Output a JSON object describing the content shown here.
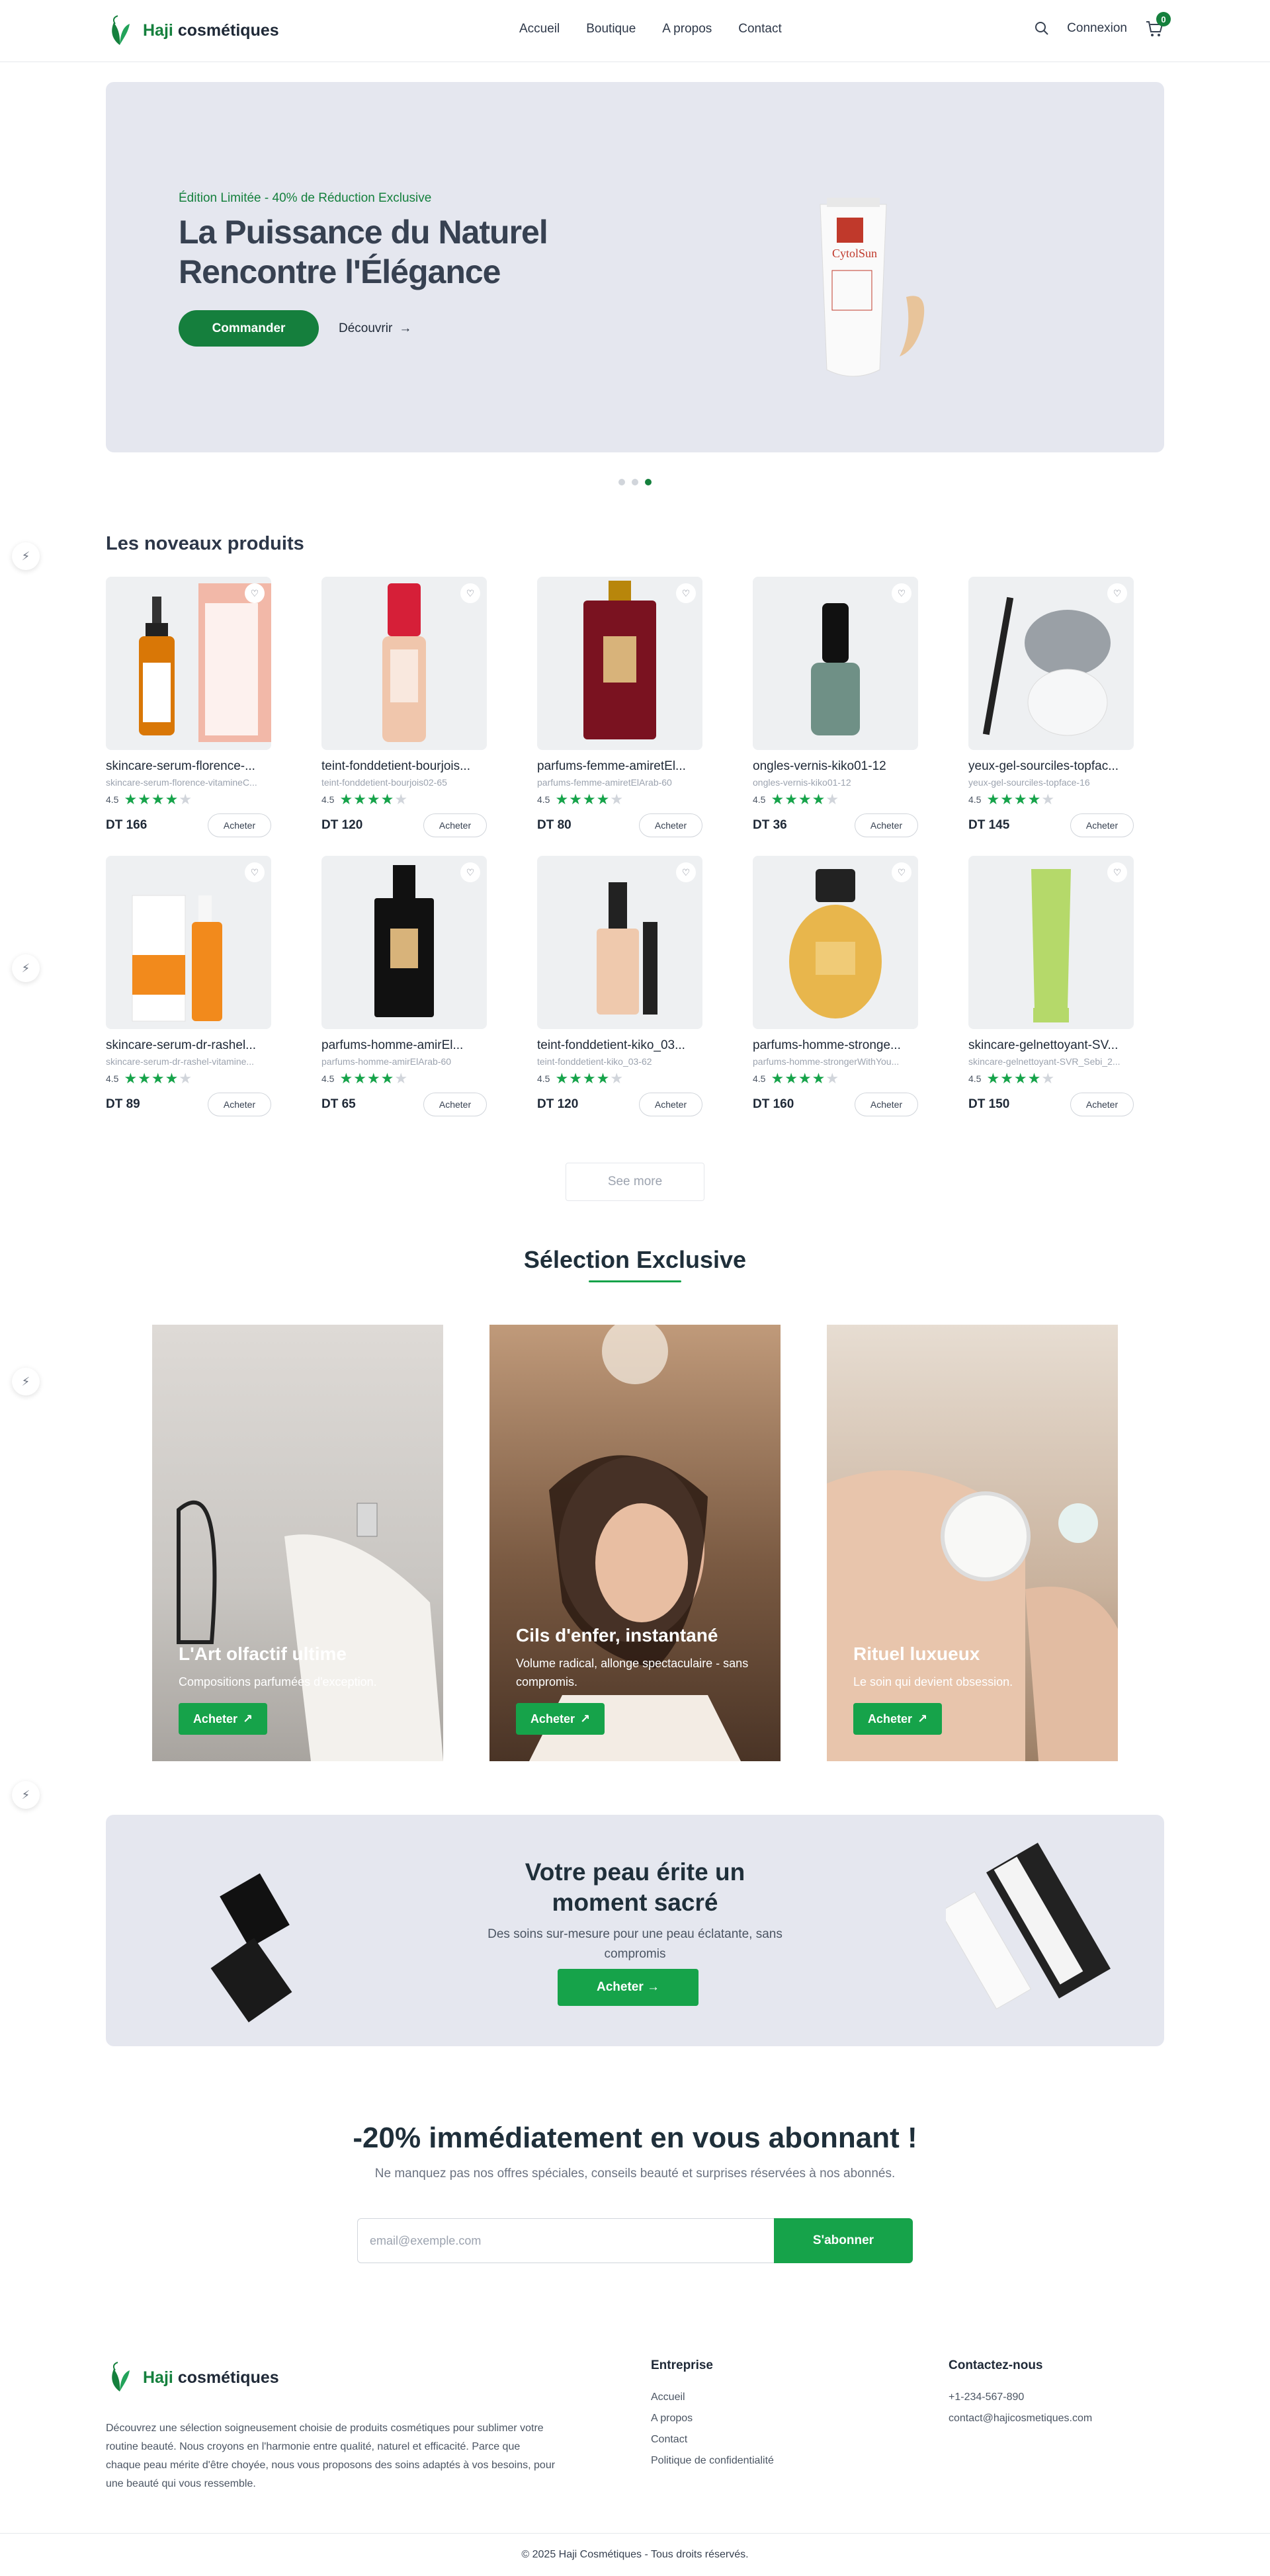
{
  "header": {
    "brand_first": "Haji",
    "brand_second": "cosmétiques",
    "nav": [
      "Accueil",
      "Boutique",
      "A propos",
      "Contact"
    ],
    "login": "Connexion",
    "cart_count": "0"
  },
  "hero": {
    "tag": "Édition Limitée - 40% de Réduction Exclusive",
    "title_line1": "La Puissance du Naturel",
    "title_line2": "Rencontre l'Élégance",
    "cta": "Commander",
    "link": "Découvrir",
    "product_label": "CytolSun"
  },
  "new_products": {
    "title": "Les noveaux produits",
    "see_more": "See more",
    "items": [
      {
        "name": "skincare-serum-florence-...",
        "slug": "skincare-serum-florence-vitamineC...",
        "rating": "4.5",
        "stars": 4,
        "price": "DT 166",
        "buy": "Acheter"
      },
      {
        "name": "teint-fonddetient-bourjois...",
        "slug": "teint-fonddetient-bourjois02-65",
        "rating": "4.5",
        "stars": 4,
        "price": "DT 120",
        "buy": "Acheter"
      },
      {
        "name": "parfums-femme-amiretEl...",
        "slug": "parfums-femme-amiretElArab-60",
        "rating": "4.5",
        "stars": 4,
        "price": "DT 80",
        "buy": "Acheter"
      },
      {
        "name": "ongles-vernis-kiko01-12",
        "slug": "ongles-vernis-kiko01-12",
        "rating": "4.5",
        "stars": 4,
        "price": "DT 36",
        "buy": "Acheter"
      },
      {
        "name": "yeux-gel-sourciles-topfac...",
        "slug": "yeux-gel-sourciles-topface-16",
        "rating": "4.5",
        "stars": 4,
        "price": "DT 145",
        "buy": "Acheter"
      },
      {
        "name": "skincare-serum-dr-rashel...",
        "slug": "skincare-serum-dr-rashel-vitamine...",
        "rating": "4.5",
        "stars": 4,
        "price": "DT 89",
        "buy": "Acheter"
      },
      {
        "name": "parfums-homme-amirEl...",
        "slug": "parfums-homme-amirElArab-60",
        "rating": "4.5",
        "stars": 4,
        "price": "DT 65",
        "buy": "Acheter"
      },
      {
        "name": "teint-fonddetient-kiko_03...",
        "slug": "teint-fonddetient-kiko_03-62",
        "rating": "4.5",
        "stars": 4,
        "price": "DT 120",
        "buy": "Acheter"
      },
      {
        "name": "parfums-homme-stronge...",
        "slug": "parfums-homme-strongerWithYou...",
        "rating": "4.5",
        "stars": 4,
        "price": "DT 160",
        "buy": "Acheter"
      },
      {
        "name": "skincare-gelnettoyant-SV...",
        "slug": "skincare-gelnettoyant-SVR_Sebi_2...",
        "rating": "4.5",
        "stars": 4,
        "price": "DT 150",
        "buy": "Acheter"
      }
    ]
  },
  "exclusive": {
    "title": "Sélection Exclusive",
    "cards": [
      {
        "title": "L'Art olfactif ultime",
        "subtitle": "Compositions parfumées d'exception.",
        "cta": "Acheter"
      },
      {
        "title": "Cils d'enfer, instantané",
        "subtitle": "Volume radical, allonge spectaculaire - sans compromis.",
        "cta": "Acheter"
      },
      {
        "title": "Rituel luxueux",
        "subtitle": "Le soin qui devient obsession.",
        "cta": "Acheter"
      }
    ]
  },
  "promo": {
    "title_line1": "Votre peau érite un",
    "title_line2": "moment sacré",
    "subtitle": "Des soins sur-mesure pour une peau éclatante, sans compromis",
    "cta": "Acheter →"
  },
  "newsletter": {
    "title": "-20% immédiatement en vous abonnant !",
    "subtitle": "Ne manquez pas nos offres spéciales, conseils beauté et surprises réservées à nos abonnés.",
    "placeholder": "email@exemple.com",
    "cta": "S'abonner"
  },
  "footer": {
    "brand_first": "Haji",
    "brand_second": "cosmétiques",
    "description": "Découvrez une sélection soigneusement choisie de produits cosmétiques pour sublimer votre routine beauté. Nous croyons en l'harmonie entre qualité, naturel et efficacité. Parce que chaque peau mérite d'être choyée, nous vous proposons des soins adaptés à vos besoins, pour une beauté qui vous ressemble.",
    "company_title": "Entreprise",
    "company_links": [
      "Accueil",
      "A propos",
      "Contact",
      "Politique de confidentialité"
    ],
    "contact_title": "Contactez-nous",
    "phone": "+1-234-567-890",
    "email": "contact@hajicosmetiques.com",
    "copyright": "© 2025 Haji Cosmétiques - Tous droits réservés."
  },
  "colors": {
    "brand_green": "#157f3d",
    "button_green": "#16a34a",
    "hero_bg": "#e5e7ef"
  }
}
